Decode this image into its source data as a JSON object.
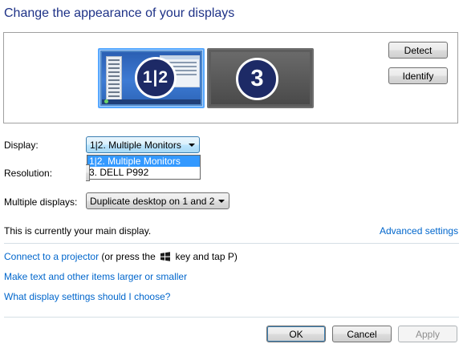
{
  "header": {
    "title": "Change the appearance of your displays"
  },
  "preview": {
    "monitor_a_label": "1|2",
    "monitor_b_label": "3",
    "detect_label": "Detect",
    "identify_label": "Identify"
  },
  "display": {
    "label": "Display:",
    "value": "1|2. Multiple Monitors",
    "options": [
      "1|2. Multiple Monitors",
      "3. DELL P992"
    ]
  },
  "resolution": {
    "label": "Resolution:"
  },
  "multiple_displays": {
    "label": "Multiple displays:",
    "value": "Duplicate desktop on 1 and 2"
  },
  "status": {
    "main_display_text": "This is currently your main display.",
    "advanced_settings_link": "Advanced settings"
  },
  "links": {
    "projector_link": "Connect to a projector",
    "projector_suffix_a": "(or press the",
    "projector_suffix_b": "key and tap P)",
    "text_size_link": "Make text and other items larger or smaller",
    "help_link": "What display settings should I choose?"
  },
  "footer": {
    "ok_label": "OK",
    "cancel_label": "Cancel",
    "apply_label": "Apply"
  },
  "colors": {
    "title": "#1e3287",
    "link": "#0066cc",
    "selection": "#3399ff",
    "badge": "#1d2a66"
  }
}
